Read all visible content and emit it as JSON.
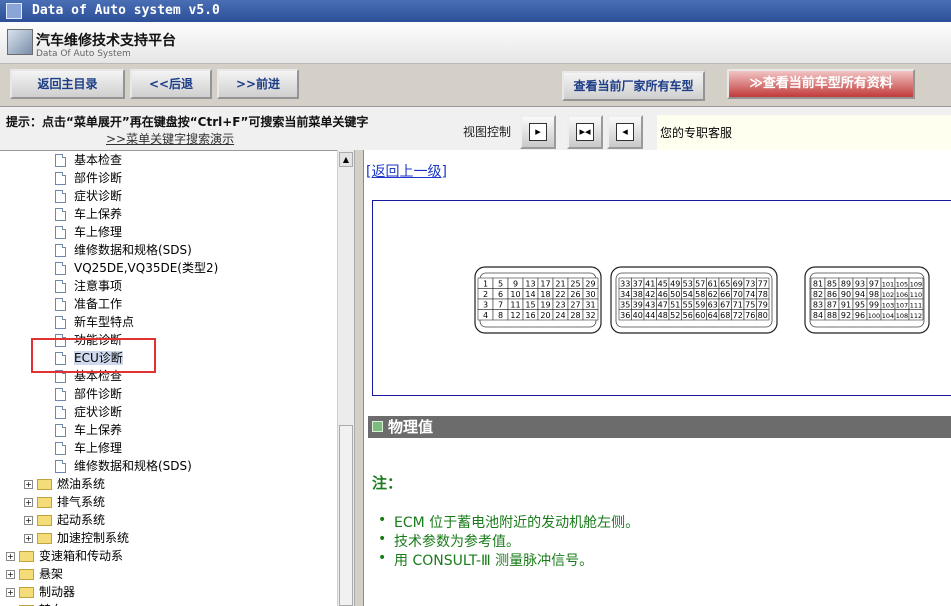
{
  "window": {
    "title": "Data of Auto system v5.0"
  },
  "header": {
    "title_cn": "汽车维修技术支持平台",
    "title_en": "Data Of Auto System"
  },
  "toolbar": {
    "back_main": "返回主目录",
    "prev": "<<后退",
    "next": ">>前进",
    "all_models": "查看当前厂家所有车型",
    "all_data": "≫查看当前车型所有资料"
  },
  "hint": {
    "line1": "提示：点击“菜单展开”再在键盘按“Ctrl+F”可搜索当前菜单关键字",
    "demo_link": ">>菜单关键字搜索演示"
  },
  "view": {
    "label": "视图控制",
    "service": "您的专职客服"
  },
  "tree": {
    "items": [
      {
        "label": "基本检查",
        "type": "doc",
        "level": 2
      },
      {
        "label": "部件诊断",
        "type": "doc",
        "level": 2
      },
      {
        "label": "症状诊断",
        "type": "doc",
        "level": 2
      },
      {
        "label": "车上保养",
        "type": "doc",
        "level": 2
      },
      {
        "label": "车上修理",
        "type": "doc",
        "level": 2
      },
      {
        "label": "维修数据和规格(SDS)",
        "type": "doc",
        "level": 2
      },
      {
        "label": "VQ25DE,VQ35DE(类型2)",
        "type": "doc",
        "level": 2
      },
      {
        "label": "注意事项",
        "type": "doc",
        "level": 2
      },
      {
        "label": "准备工作",
        "type": "doc",
        "level": 2
      },
      {
        "label": "新车型特点",
        "type": "doc",
        "level": 2
      },
      {
        "label": "功能诊断",
        "type": "doc",
        "level": 2
      },
      {
        "label": "ECU诊断",
        "type": "doc",
        "level": 2,
        "selected": true
      },
      {
        "label": "基本检查",
        "type": "doc",
        "level": 2
      },
      {
        "label": "部件诊断",
        "type": "doc",
        "level": 2
      },
      {
        "label": "症状诊断",
        "type": "doc",
        "level": 2
      },
      {
        "label": "车上保养",
        "type": "doc",
        "level": 2
      },
      {
        "label": "车上修理",
        "type": "doc",
        "level": 2
      },
      {
        "label": "维修数据和规格(SDS)",
        "type": "doc",
        "level": 2
      },
      {
        "label": "燃油系统",
        "type": "folder",
        "level": 1
      },
      {
        "label": "排气系统",
        "type": "folder",
        "level": 1
      },
      {
        "label": "起动系统",
        "type": "folder",
        "level": 1
      },
      {
        "label": "加速控制系统",
        "type": "folder",
        "level": 1
      },
      {
        "label": "变速箱和传动系",
        "type": "folder",
        "level": 0
      },
      {
        "label": "悬架",
        "type": "folder",
        "level": 0
      },
      {
        "label": "制动器",
        "type": "folder",
        "level": 0
      },
      {
        "label": "转向",
        "type": "folder",
        "level": 0
      }
    ]
  },
  "content": {
    "back_link": "[返回上一级]",
    "connectors": [
      {
        "rows": [
          [
            "1",
            "5",
            "9",
            "13",
            "17",
            "21",
            "25",
            "29"
          ],
          [
            "2",
            "6",
            "10",
            "14",
            "18",
            "22",
            "26",
            "30"
          ],
          [
            "3",
            "7",
            "11",
            "15",
            "19",
            "23",
            "27",
            "31"
          ],
          [
            "4",
            "8",
            "12",
            "16",
            "20",
            "24",
            "28",
            "32"
          ]
        ]
      },
      {
        "rows": [
          [
            "33",
            "37",
            "41",
            "45",
            "49",
            "53",
            "57",
            "61",
            "65",
            "69",
            "73",
            "77"
          ],
          [
            "34",
            "38",
            "42",
            "46",
            "50",
            "54",
            "58",
            "62",
            "66",
            "70",
            "74",
            "78"
          ],
          [
            "35",
            "39",
            "43",
            "47",
            "51",
            "55",
            "59",
            "63",
            "67",
            "71",
            "75",
            "79"
          ],
          [
            "36",
            "40",
            "44",
            "48",
            "52",
            "56",
            "60",
            "64",
            "68",
            "72",
            "76",
            "80"
          ]
        ]
      },
      {
        "rows": [
          [
            "81",
            "85",
            "89",
            "93",
            "97",
            "101",
            "105",
            "109"
          ],
          [
            "82",
            "86",
            "90",
            "94",
            "98",
            "102",
            "106",
            "110"
          ],
          [
            "83",
            "87",
            "91",
            "95",
            "99",
            "103",
            "107",
            "111"
          ],
          [
            "84",
            "88",
            "92",
            "96",
            "100",
            "104",
            "108",
            "112"
          ]
        ]
      }
    ],
    "section_title": "物理值",
    "note_label": "注：",
    "bullets": [
      "ECM 位于蓄电池附近的发动机舱左侧。",
      "技术参数为参考值。",
      "用  CONSULT-Ⅲ 测量脉冲信号。"
    ]
  },
  "colors": {
    "note_green": "#1a7b1a",
    "link_blue": "#1d36c9",
    "highlight_red": "#e23131"
  }
}
